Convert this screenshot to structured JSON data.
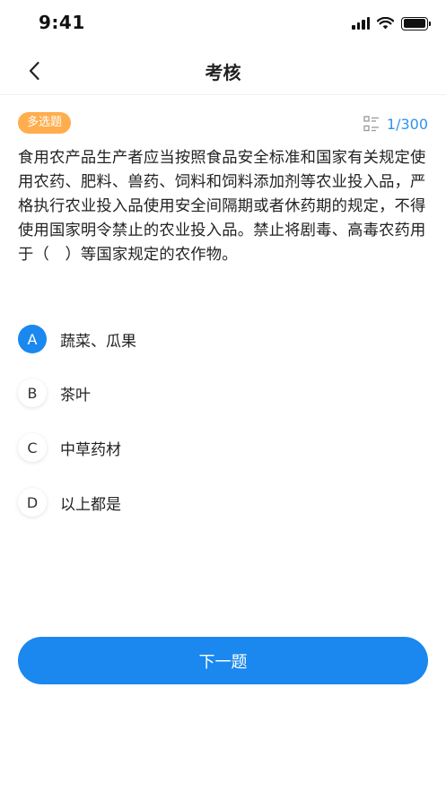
{
  "status_bar": {
    "time": "9:41"
  },
  "nav": {
    "title": "考核"
  },
  "question": {
    "type_label": "多选题",
    "progress": "1/300",
    "text": "食用农产品生产者应当按照食品安全标准和国家有关规定使用农药、肥料、兽药、饲料和饲料添加剂等农业投入品，严格执行农业投入品使用安全间隔期或者休药期的规定，不得使用国家明令禁止的农业投入品。禁止将剧毒、高毒农药用于（　）等国家规定的农作物。"
  },
  "options": [
    {
      "letter": "A",
      "label": "蔬菜、瓜果",
      "selected": true
    },
    {
      "letter": "B",
      "label": "茶叶",
      "selected": false
    },
    {
      "letter": "C",
      "label": "中草药材",
      "selected": false
    },
    {
      "letter": "D",
      "label": "以上都是",
      "selected": false
    }
  ],
  "actions": {
    "next_label": "下一题"
  },
  "colors": {
    "accent": "#1a88ee",
    "badge": "#ffad4d",
    "progress": "#2f93ec"
  }
}
